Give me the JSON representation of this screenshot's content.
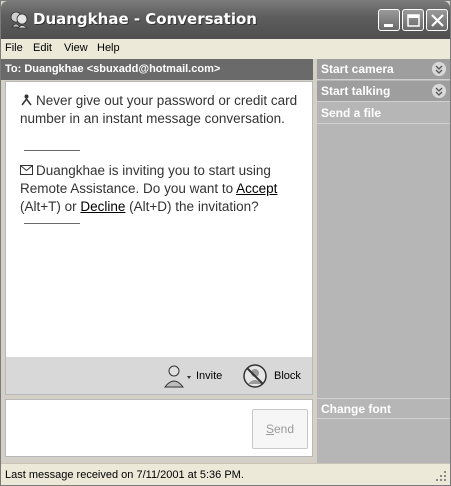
{
  "window": {
    "title": "Duangkhae - Conversation",
    "icon": "msn-messenger-icon"
  },
  "menu": [
    "File",
    "Edit",
    "View",
    "Help"
  ],
  "to_bar": {
    "text": "To:  Duangkhae <sbuxadd@hotmail.com>"
  },
  "messages": {
    "warning": "Never give out your password or credit card number in an instant message conversation.",
    "invite_intro": "Duangkhae is inviting you to start using Remote Assistance. Do you want to ",
    "accept_link": "Accept",
    "accept_shortcut": " (Alt+T) or ",
    "decline_link": "Decline",
    "decline_shortcut": " (Alt+D) the invitation?"
  },
  "actions": {
    "invite_label": "Invite",
    "block_label": "Block"
  },
  "input": {
    "send_label": "Send",
    "send_mnemonic": "S",
    "send_rest": "end"
  },
  "sidebar": {
    "items": [
      "Start camera",
      "Start talking",
      "Send a file"
    ],
    "bottom_item": "Change font"
  },
  "status": {
    "text": "Last message received on 7/11/2001 at 5:36 PM."
  },
  "colors": {
    "title_bar": "#5e5e5e",
    "sidebar": "#b6b6b6",
    "to_bar": "#6a6a6a",
    "status_bar": "#ece9d8"
  }
}
